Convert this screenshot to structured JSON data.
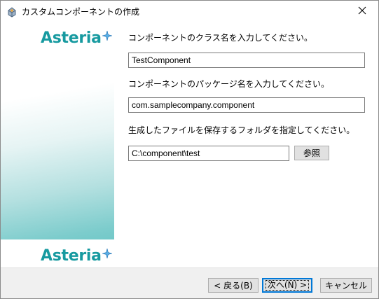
{
  "window": {
    "title": "カスタムコンポーネントの作成"
  },
  "icons": {
    "app": "puzzle-app-icon",
    "close": "close-icon",
    "logo_star": "sparkle-star-icon"
  },
  "colors": {
    "brand_teal": "#179aa0",
    "primary_focus": "#0078d7"
  },
  "branding": {
    "logo_top": "Asteria",
    "logo_bottom": "Asteria"
  },
  "form": {
    "class_prompt": "コンポーネントのクラス名を入力してください。",
    "class_value": "TestComponent",
    "package_prompt": "コンポーネントのパッケージ名を入力してください。",
    "package_value": "com.samplecompany.component",
    "folder_prompt": "生成したファイルを保存するフォルダを指定してください。",
    "folder_value": "C:\\component\\test",
    "browse_label": "参照"
  },
  "footer": {
    "back_label": "< 戻る(B)",
    "next_label": "次へ(N) >",
    "cancel_label": "キャンセル"
  }
}
